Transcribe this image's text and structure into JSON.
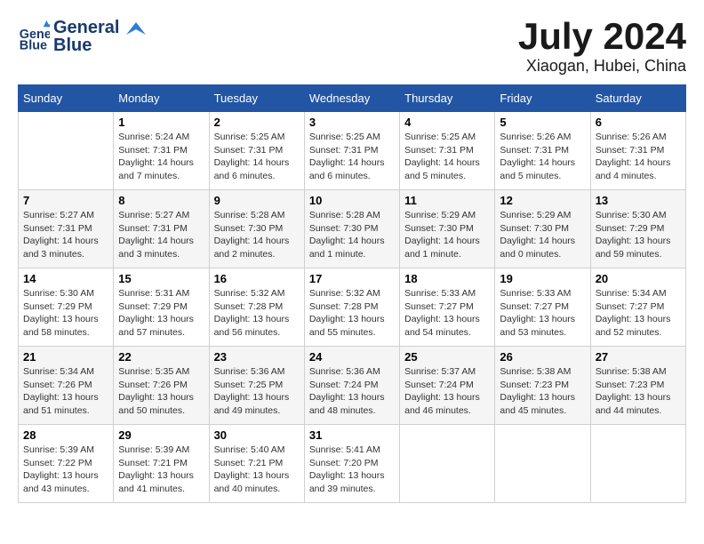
{
  "logo": {
    "line1": "General",
    "line2": "Blue"
  },
  "title": "July 2024",
  "location": "Xiaogan, Hubei, China",
  "headers": [
    "Sunday",
    "Monday",
    "Tuesday",
    "Wednesday",
    "Thursday",
    "Friday",
    "Saturday"
  ],
  "weeks": [
    [
      {
        "day": "",
        "info": ""
      },
      {
        "day": "1",
        "info": "Sunrise: 5:24 AM\nSunset: 7:31 PM\nDaylight: 14 hours\nand 7 minutes."
      },
      {
        "day": "2",
        "info": "Sunrise: 5:25 AM\nSunset: 7:31 PM\nDaylight: 14 hours\nand 6 minutes."
      },
      {
        "day": "3",
        "info": "Sunrise: 5:25 AM\nSunset: 7:31 PM\nDaylight: 14 hours\nand 6 minutes."
      },
      {
        "day": "4",
        "info": "Sunrise: 5:25 AM\nSunset: 7:31 PM\nDaylight: 14 hours\nand 5 minutes."
      },
      {
        "day": "5",
        "info": "Sunrise: 5:26 AM\nSunset: 7:31 PM\nDaylight: 14 hours\nand 5 minutes."
      },
      {
        "day": "6",
        "info": "Sunrise: 5:26 AM\nSunset: 7:31 PM\nDaylight: 14 hours\nand 4 minutes."
      }
    ],
    [
      {
        "day": "7",
        "info": "Sunrise: 5:27 AM\nSunset: 7:31 PM\nDaylight: 14 hours\nand 3 minutes."
      },
      {
        "day": "8",
        "info": "Sunrise: 5:27 AM\nSunset: 7:31 PM\nDaylight: 14 hours\nand 3 minutes."
      },
      {
        "day": "9",
        "info": "Sunrise: 5:28 AM\nSunset: 7:30 PM\nDaylight: 14 hours\nand 2 minutes."
      },
      {
        "day": "10",
        "info": "Sunrise: 5:28 AM\nSunset: 7:30 PM\nDaylight: 14 hours\nand 1 minute."
      },
      {
        "day": "11",
        "info": "Sunrise: 5:29 AM\nSunset: 7:30 PM\nDaylight: 14 hours\nand 1 minute."
      },
      {
        "day": "12",
        "info": "Sunrise: 5:29 AM\nSunset: 7:30 PM\nDaylight: 14 hours\nand 0 minutes."
      },
      {
        "day": "13",
        "info": "Sunrise: 5:30 AM\nSunset: 7:29 PM\nDaylight: 13 hours\nand 59 minutes."
      }
    ],
    [
      {
        "day": "14",
        "info": "Sunrise: 5:30 AM\nSunset: 7:29 PM\nDaylight: 13 hours\nand 58 minutes."
      },
      {
        "day": "15",
        "info": "Sunrise: 5:31 AM\nSunset: 7:29 PM\nDaylight: 13 hours\nand 57 minutes."
      },
      {
        "day": "16",
        "info": "Sunrise: 5:32 AM\nSunset: 7:28 PM\nDaylight: 13 hours\nand 56 minutes."
      },
      {
        "day": "17",
        "info": "Sunrise: 5:32 AM\nSunset: 7:28 PM\nDaylight: 13 hours\nand 55 minutes."
      },
      {
        "day": "18",
        "info": "Sunrise: 5:33 AM\nSunset: 7:27 PM\nDaylight: 13 hours\nand 54 minutes."
      },
      {
        "day": "19",
        "info": "Sunrise: 5:33 AM\nSunset: 7:27 PM\nDaylight: 13 hours\nand 53 minutes."
      },
      {
        "day": "20",
        "info": "Sunrise: 5:34 AM\nSunset: 7:27 PM\nDaylight: 13 hours\nand 52 minutes."
      }
    ],
    [
      {
        "day": "21",
        "info": "Sunrise: 5:34 AM\nSunset: 7:26 PM\nDaylight: 13 hours\nand 51 minutes."
      },
      {
        "day": "22",
        "info": "Sunrise: 5:35 AM\nSunset: 7:26 PM\nDaylight: 13 hours\nand 50 minutes."
      },
      {
        "day": "23",
        "info": "Sunrise: 5:36 AM\nSunset: 7:25 PM\nDaylight: 13 hours\nand 49 minutes."
      },
      {
        "day": "24",
        "info": "Sunrise: 5:36 AM\nSunset: 7:24 PM\nDaylight: 13 hours\nand 48 minutes."
      },
      {
        "day": "25",
        "info": "Sunrise: 5:37 AM\nSunset: 7:24 PM\nDaylight: 13 hours\nand 46 minutes."
      },
      {
        "day": "26",
        "info": "Sunrise: 5:38 AM\nSunset: 7:23 PM\nDaylight: 13 hours\nand 45 minutes."
      },
      {
        "day": "27",
        "info": "Sunrise: 5:38 AM\nSunset: 7:23 PM\nDaylight: 13 hours\nand 44 minutes."
      }
    ],
    [
      {
        "day": "28",
        "info": "Sunrise: 5:39 AM\nSunset: 7:22 PM\nDaylight: 13 hours\nand 43 minutes."
      },
      {
        "day": "29",
        "info": "Sunrise: 5:39 AM\nSunset: 7:21 PM\nDaylight: 13 hours\nand 41 minutes."
      },
      {
        "day": "30",
        "info": "Sunrise: 5:40 AM\nSunset: 7:21 PM\nDaylight: 13 hours\nand 40 minutes."
      },
      {
        "day": "31",
        "info": "Sunrise: 5:41 AM\nSunset: 7:20 PM\nDaylight: 13 hours\nand 39 minutes."
      },
      {
        "day": "",
        "info": ""
      },
      {
        "day": "",
        "info": ""
      },
      {
        "day": "",
        "info": ""
      }
    ]
  ]
}
